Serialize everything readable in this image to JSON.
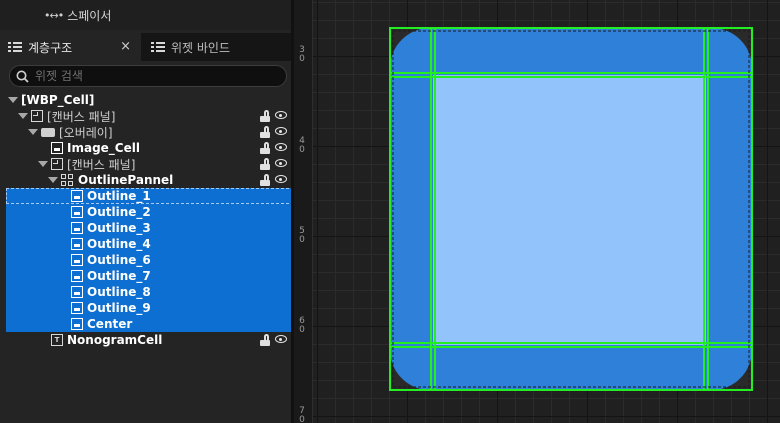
{
  "palette": {
    "spacer_label": "스페이서",
    "spacer_icon": "spacer-icon"
  },
  "tabs": {
    "hierarchy": {
      "label": "계층구조",
      "icon": "list-icon",
      "close": "×"
    },
    "bind": {
      "label": "위젯 바인드",
      "icon": "list-icon"
    }
  },
  "search": {
    "placeholder": "위젯 검색",
    "value": ""
  },
  "tree": [
    {
      "label": "[WBP_Cell]",
      "depth": 0,
      "expanded": true,
      "icon": "none",
      "selected": false,
      "bold": true,
      "lock_eye": false
    },
    {
      "label": "[캔버스 패널]",
      "depth": 1,
      "expanded": true,
      "icon": "canvas-panel-icon",
      "selected": false,
      "bold": false,
      "lock_eye": true
    },
    {
      "label": "[오버레이]",
      "depth": 2,
      "expanded": true,
      "icon": "overlay-icon",
      "selected": false,
      "bold": false,
      "lock_eye": true
    },
    {
      "label": "Image_Cell",
      "depth": 3,
      "expanded": null,
      "icon": "image-icon",
      "selected": false,
      "bold": true,
      "lock_eye": true
    },
    {
      "label": "[캔버스 패널]",
      "depth": 3,
      "expanded": true,
      "icon": "canvas-panel-icon",
      "selected": false,
      "bold": false,
      "lock_eye": true
    },
    {
      "label": "OutlinePannel",
      "depth": 4,
      "expanded": true,
      "icon": "uniform-grid-icon",
      "selected": false,
      "bold": true,
      "lock_eye": true
    },
    {
      "label": "Outline_1",
      "depth": 5,
      "expanded": null,
      "icon": "image-icon",
      "selected": true,
      "bold": true,
      "lock_eye": true
    },
    {
      "label": "Outline_2",
      "depth": 5,
      "expanded": null,
      "icon": "image-icon",
      "selected": true,
      "bold": true,
      "lock_eye": true
    },
    {
      "label": "Outline_3",
      "depth": 5,
      "expanded": null,
      "icon": "image-icon",
      "selected": true,
      "bold": true,
      "lock_eye": true
    },
    {
      "label": "Outline_4",
      "depth": 5,
      "expanded": null,
      "icon": "image-icon",
      "selected": true,
      "bold": true,
      "lock_eye": true
    },
    {
      "label": "Outline_6",
      "depth": 5,
      "expanded": null,
      "icon": "image-icon",
      "selected": true,
      "bold": true,
      "lock_eye": true
    },
    {
      "label": "Outline_7",
      "depth": 5,
      "expanded": null,
      "icon": "image-icon",
      "selected": true,
      "bold": true,
      "lock_eye": true
    },
    {
      "label": "Outline_8",
      "depth": 5,
      "expanded": null,
      "icon": "image-icon",
      "selected": true,
      "bold": true,
      "lock_eye": true
    },
    {
      "label": "Outline_9",
      "depth": 5,
      "expanded": null,
      "icon": "image-icon",
      "selected": true,
      "bold": true,
      "lock_eye": true
    },
    {
      "label": "Center",
      "depth": 5,
      "expanded": null,
      "icon": "image-icon",
      "selected": true,
      "bold": true,
      "lock_eye": true
    },
    {
      "label": "NonogramCell",
      "depth": 3,
      "expanded": null,
      "icon": "text-block-icon",
      "selected": false,
      "bold": true,
      "lock_eye": true
    }
  ],
  "canvas": {
    "ruler_labels": [
      "3\n0",
      "4\n0",
      "5\n0",
      "6\n0",
      "7\n0"
    ],
    "colors": {
      "outline_blue": "#2f80d8",
      "center_blue": "#93c3fb",
      "selection_green": "#22ee22",
      "selection_blue": "#0c6fd1"
    }
  }
}
